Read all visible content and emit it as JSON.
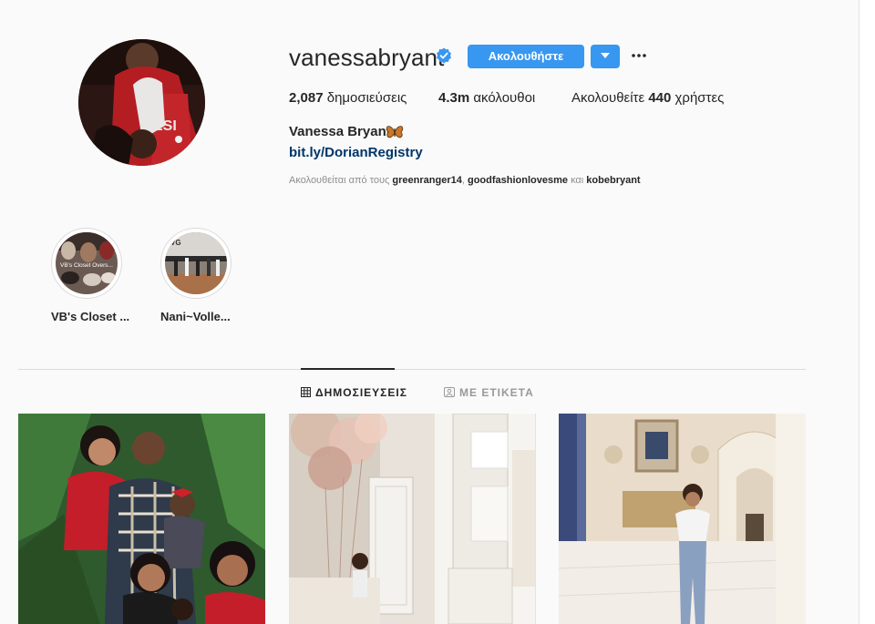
{
  "profile": {
    "username": "vanessabryant",
    "verified": true,
    "follow_label": "Ακολουθήστε",
    "posts_count": "2,087",
    "posts_label": "δημοσιεύσεις",
    "followers_count": "4.3m",
    "followers_label": "ακόλουθοι",
    "following_prefix": "Ακολουθείτε",
    "following_count": "440",
    "following_suffix": "χρήστες",
    "full_name": "Vanessa Bryant",
    "bio_link": "bit.ly/DorianRegistry",
    "followed_by_prefix": "Ακολουθείται από τους",
    "followed_by_users": [
      "greenranger14",
      "goodfashionlovesme",
      "kobebryant"
    ],
    "followed_by_sep": ",",
    "followed_by_and": "και"
  },
  "highlights": [
    {
      "label": "VB's Closet ...",
      "overlay_text": "VB's Closet Overs..."
    },
    {
      "label": "Nani~Volle...",
      "overlay_text": "VG"
    }
  ],
  "tabs": [
    {
      "label": "ΔΗΜΟΣΙΕΥΣΕΙΣ",
      "icon": "grid-icon",
      "active": true
    },
    {
      "label": "ΜΕ ΕΤΙΚΕΤΑ",
      "icon": "tag-icon",
      "active": false
    }
  ],
  "posts": [
    {
      "description": "family-christmas-photo"
    },
    {
      "description": "balloons-kitchen-photo"
    },
    {
      "description": "child-in-hallway-photo"
    }
  ],
  "colors": {
    "accent": "#3897f0",
    "link": "#003569",
    "muted": "#8e8e8e",
    "background": "#fafafa"
  }
}
